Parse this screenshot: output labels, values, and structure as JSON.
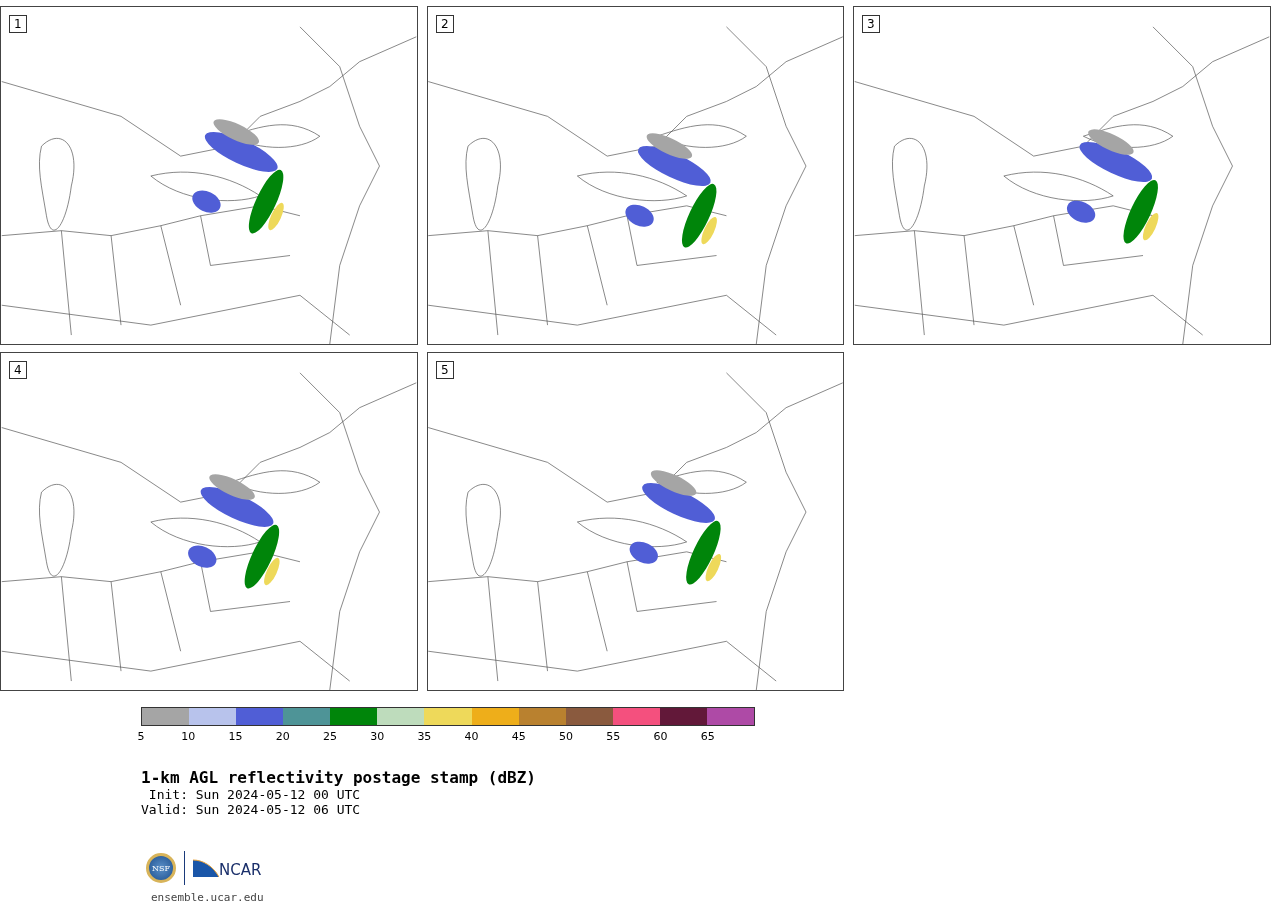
{
  "panels": [
    {
      "label": "1"
    },
    {
      "label": "2"
    },
    {
      "label": "3"
    },
    {
      "label": "4"
    },
    {
      "label": "5"
    }
  ],
  "colorbar": {
    "segments": [
      {
        "color": "#a5a5a5"
      },
      {
        "color": "#b8c3ec"
      },
      {
        "color": "#505ed6"
      },
      {
        "color": "#4e9497"
      },
      {
        "color": "#00850a"
      },
      {
        "color": "#bedcbc"
      },
      {
        "color": "#eed95a"
      },
      {
        "color": "#eeae1a"
      },
      {
        "color": "#b9812f"
      },
      {
        "color": "#8a5a3e"
      },
      {
        "color": "#f4507e"
      },
      {
        "color": "#621839"
      },
      {
        "color": "#ae4aa6"
      }
    ],
    "ticks": [
      "5",
      "10",
      "15",
      "20",
      "25",
      "30",
      "35",
      "40",
      "45",
      "50",
      "55",
      "60",
      "65"
    ]
  },
  "title": "1-km AGL reflectivity postage stamp (dBZ)",
  "init": " Init: Sun 2024-05-12 00 UTC",
  "valid": "Valid: Sun 2024-05-12 06 UTC",
  "logos": {
    "nsf": "NSF",
    "ncar": "NCAR"
  },
  "site": "ensemble.ucar.edu"
}
